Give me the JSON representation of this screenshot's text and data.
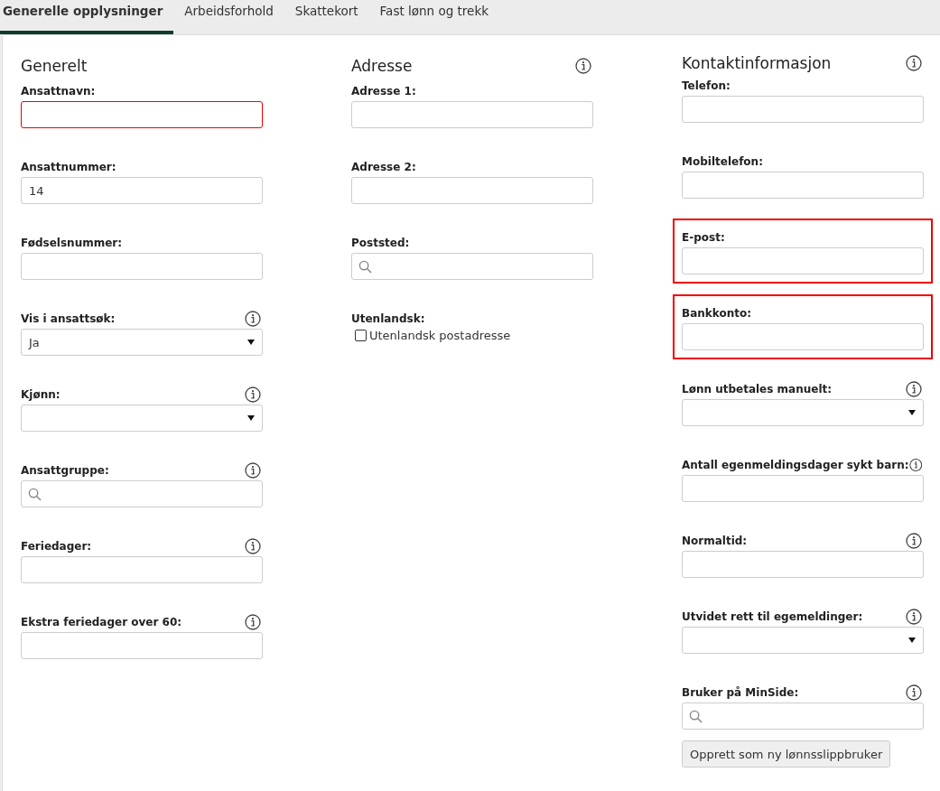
{
  "tabs": [
    {
      "label": "Generelle opplysninger",
      "selected": true
    },
    {
      "label": "Arbeidsforhold",
      "selected": false
    },
    {
      "label": "Skattekort",
      "selected": false
    },
    {
      "label": "Fast lønn og trekk",
      "selected": false
    }
  ],
  "columns": [
    {
      "title": "Generelt",
      "fields": [
        {
          "kind": "text",
          "label": "Ansattnavn:",
          "invalid": true
        },
        {
          "kind": "text",
          "label": "Ansattnummer:",
          "value": "14"
        },
        {
          "kind": "text",
          "label": "Fødselsnummer:"
        },
        {
          "kind": "select",
          "label": "Vis i ansattsøk:",
          "info": true,
          "value": "Ja"
        },
        {
          "kind": "select",
          "label": "Kjønn:",
          "info": true
        },
        {
          "kind": "search",
          "label": "Ansattgruppe:",
          "info": true
        },
        {
          "kind": "text",
          "label": "Feriedager:",
          "info": true
        },
        {
          "kind": "text",
          "label": "Ekstra feriedager over 60:",
          "info": true
        }
      ]
    },
    {
      "title": "Adresse",
      "info": true,
      "fields": [
        {
          "kind": "text",
          "label": "Adresse 1:"
        },
        {
          "kind": "text",
          "label": "Adresse 2:"
        },
        {
          "kind": "search",
          "label": "Poststed:"
        },
        {
          "kind": "checkbox",
          "label": "Utenlandsk:",
          "option": "Utenlandsk postadresse",
          "checked": false
        }
      ]
    },
    {
      "title": "Kontaktinformasjon",
      "info": true,
      "fields": [
        {
          "kind": "text",
          "label": "Telefon:"
        },
        {
          "kind": "text",
          "label": "Mobiltelefon:"
        },
        {
          "kind": "text",
          "label": "E-post:",
          "highlighted": true
        },
        {
          "kind": "text",
          "label": "Bankkonto:",
          "highlighted": true
        },
        {
          "kind": "select",
          "label": "Lønn utbetales manuelt:",
          "info": true
        },
        {
          "kind": "text",
          "label": "Antall egenmeldingsdager sykt barn:",
          "info": true
        },
        {
          "kind": "text",
          "label": "Normaltid:",
          "info": true
        },
        {
          "kind": "select",
          "label": "Utvidet rett til egemeldinger:",
          "info": true
        },
        {
          "kind": "search",
          "label": "Bruker på MinSide:",
          "info": true,
          "button": "Opprett som ny lønnsslippbruker"
        }
      ]
    }
  ]
}
